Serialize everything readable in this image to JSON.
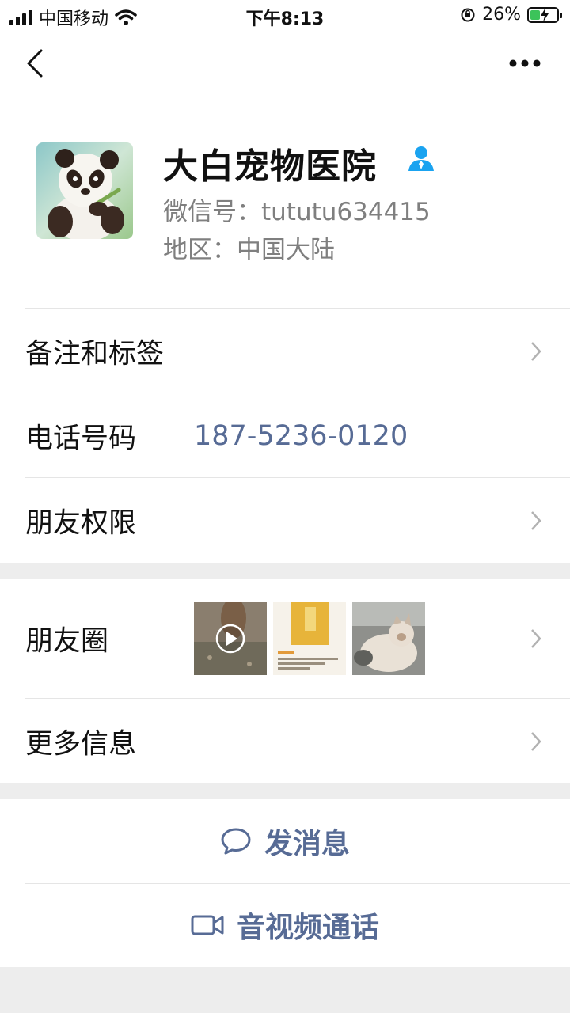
{
  "status_bar": {
    "carrier": "中国移动",
    "time": "下午8:13",
    "battery": "26%"
  },
  "profile": {
    "name": "大白宠物医院",
    "wechat_id": "微信号：tututu634415",
    "region": "地区：中国大陆"
  },
  "cells": {
    "remarks_label": "备注和标签",
    "phone_label": "电话号码",
    "phone_value": "187-5236-0120",
    "permissions_label": "朋友权限",
    "moments_label": "朋友圈",
    "more_info_label": "更多信息"
  },
  "actions": {
    "message_label": "发消息",
    "call_label": "音视频通话"
  },
  "colors": {
    "link": "#576b95",
    "secondary_text": "#7f7f7f",
    "background": "#ededed",
    "badge": "#1aa3f0"
  },
  "icons": [
    "back-arrow-icon",
    "more-icon",
    "user-badge-icon",
    "chevron-right-icon",
    "chat-bubble-icon",
    "video-camera-icon",
    "play-icon",
    "wifi-icon",
    "signal-icon",
    "battery-icon",
    "rotation-lock-icon"
  ]
}
